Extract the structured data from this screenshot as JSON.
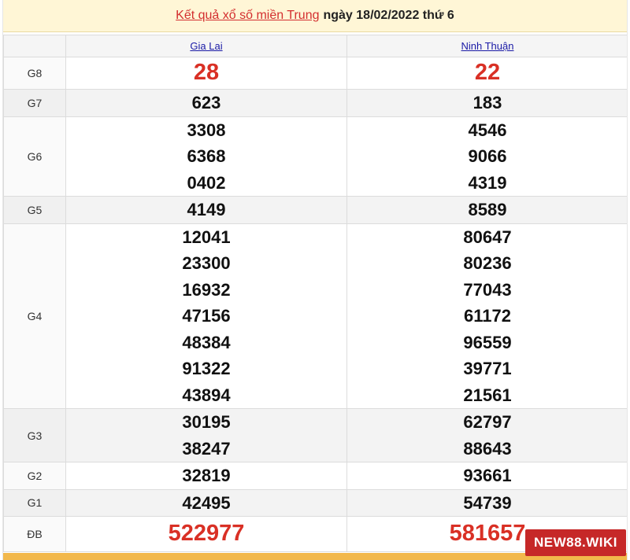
{
  "title": {
    "link_text": "Kết quả xổ số miền Trung",
    "rest_text": "ngày 18/02/2022 thứ 6"
  },
  "provinces": [
    "Gia Lai",
    "Ninh Thuận"
  ],
  "prizes": [
    {
      "label": "G8",
      "gia_lai": [
        "28"
      ],
      "ninh_thuan": [
        "22"
      ]
    },
    {
      "label": "G7",
      "gia_lai": [
        "623"
      ],
      "ninh_thuan": [
        "183"
      ]
    },
    {
      "label": "G6",
      "gia_lai": [
        "3308",
        "6368",
        "0402"
      ],
      "ninh_thuan": [
        "4546",
        "9066",
        "4319"
      ]
    },
    {
      "label": "G5",
      "gia_lai": [
        "4149"
      ],
      "ninh_thuan": [
        "8589"
      ]
    },
    {
      "label": "G4",
      "gia_lai": [
        "12041",
        "23300",
        "16932",
        "47156",
        "48384",
        "91322",
        "43894"
      ],
      "ninh_thuan": [
        "80647",
        "80236",
        "77043",
        "61172",
        "96559",
        "39771",
        "21561"
      ]
    },
    {
      "label": "G3",
      "gia_lai": [
        "30195",
        "38247"
      ],
      "ninh_thuan": [
        "62797",
        "88643"
      ]
    },
    {
      "label": "G2",
      "gia_lai": [
        "32819"
      ],
      "ninh_thuan": [
        "93661"
      ]
    },
    {
      "label": "G1",
      "gia_lai": [
        "42495"
      ],
      "ninh_thuan": [
        "54739"
      ]
    },
    {
      "label": "ĐB",
      "gia_lai": [
        "522977"
      ],
      "ninh_thuan": [
        "581657"
      ]
    }
  ],
  "watermark": "NEW88.WIKI",
  "colors": {
    "highlight_red": "#d93025",
    "title_background": "#fff6d6",
    "province_link": "#1a1aa6",
    "watermark_background": "#c62828",
    "bottom_strip": "#f2b84b"
  }
}
